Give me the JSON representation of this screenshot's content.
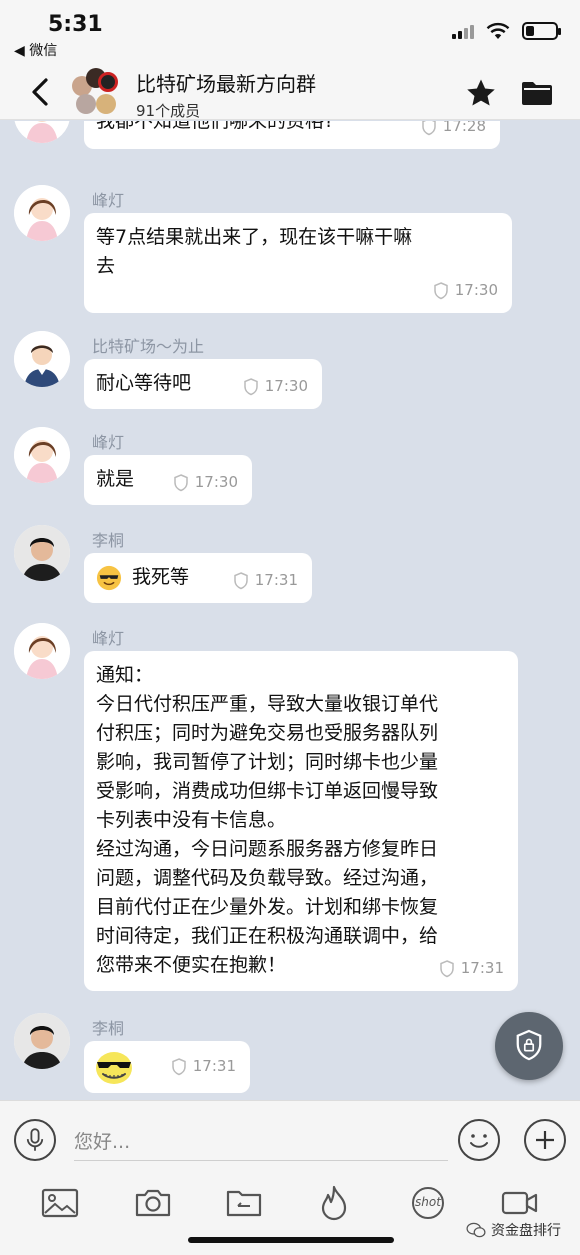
{
  "status_bar": {
    "time": "5:31",
    "back_app": "◀ 微信"
  },
  "header": {
    "title": "比特矿场最新方向群",
    "member_count": "91个成员"
  },
  "messages": [
    {
      "sender": "",
      "text": "我都不知道他们哪来的资格?",
      "time": "17:28"
    },
    {
      "sender": "峰灯",
      "text": "等7点结果就出来了，现在该干嘛干嘛\n去",
      "time": "17:30"
    },
    {
      "sender": "比特矿场～为止",
      "text": "耐心等待吧",
      "time": "17:30"
    },
    {
      "sender": "峰灯",
      "text": "就是",
      "time": "17:30"
    },
    {
      "sender": "李桐",
      "text": "我死等",
      "time": "17:31"
    },
    {
      "sender": "峰灯",
      "text": "通知：\n今日代付积压严重，导致大量收银订单代\n付积压；同时为避免交易也受服务器队列\n影响，我司暂停了计划；同时绑卡也少量\n受影响，消费成功但绑卡订单返回慢导致\n卡列表中没有卡信息。\n经过沟通，今日问题系服务器方修复昨日\n问题，调整代码及负载导致。经过沟通，\n目前代付正在少量外发。计划和绑卡恢复\n时间待定，我们正在积极沟通联调中，给\n您带来不便实在抱歉！",
      "time": "17:31"
    },
    {
      "sender": "李桐",
      "text": "",
      "time": "17:31"
    }
  ],
  "input": {
    "placeholder": "您好..."
  },
  "toolbar": {
    "shot_label": "shot"
  },
  "watermark": {
    "text": "资金盘排行"
  }
}
